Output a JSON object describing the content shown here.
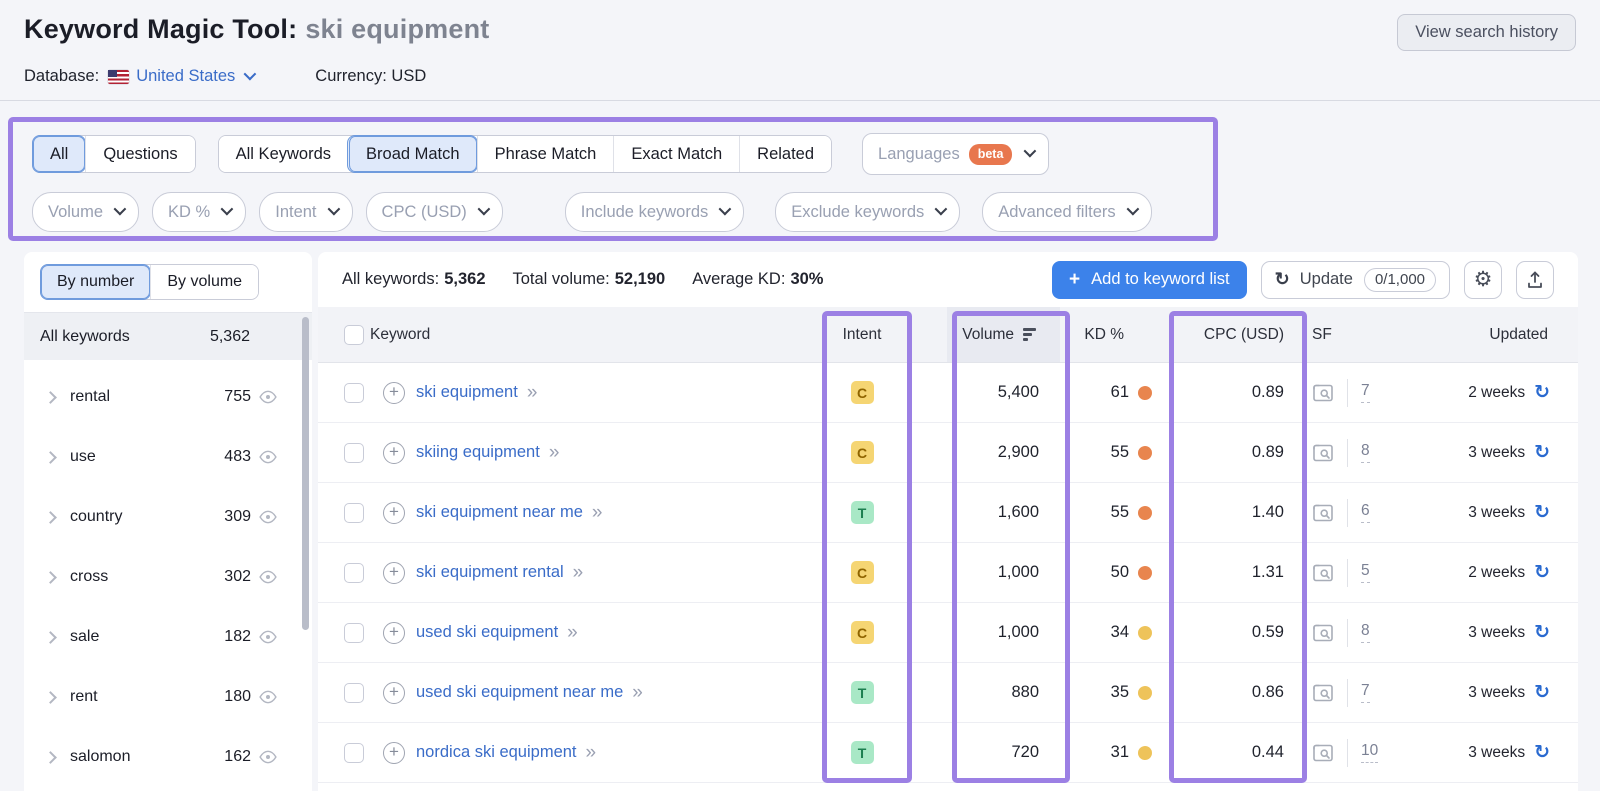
{
  "header": {
    "title": "Keyword Magic Tool:",
    "query": "ski equipment",
    "database_label": "Database:",
    "database_value": "United States",
    "currency_label": "Currency:",
    "currency_value": "USD",
    "view_history_label": "View search history"
  },
  "filters": {
    "scope_tabs": [
      {
        "label": "All",
        "selected": true
      },
      {
        "label": "Questions",
        "selected": false
      }
    ],
    "match_tabs": [
      {
        "label": "All Keywords",
        "selected": false
      },
      {
        "label": "Broad Match",
        "selected": true
      },
      {
        "label": "Phrase Match",
        "selected": false
      },
      {
        "label": "Exact Match",
        "selected": false
      },
      {
        "label": "Related",
        "selected": false
      }
    ],
    "languages": {
      "label": "Languages",
      "badge": "beta"
    },
    "dropdowns": [
      {
        "label": "Volume"
      },
      {
        "label": "KD %"
      },
      {
        "label": "Intent"
      },
      {
        "label": "CPC (USD)"
      },
      {
        "label": "Include keywords"
      },
      {
        "label": "Exclude keywords"
      },
      {
        "label": "Advanced filters"
      }
    ]
  },
  "sidebar": {
    "tabs": [
      {
        "label": "By number",
        "selected": true
      },
      {
        "label": "By volume",
        "selected": false
      }
    ],
    "all_row": {
      "label": "All keywords",
      "count": "5,362"
    },
    "groups": [
      {
        "label": "rental",
        "count": "755"
      },
      {
        "label": "use",
        "count": "483"
      },
      {
        "label": "country",
        "count": "309"
      },
      {
        "label": "cross",
        "count": "302"
      },
      {
        "label": "sale",
        "count": "182"
      },
      {
        "label": "rent",
        "count": "180"
      },
      {
        "label": "salomon",
        "count": "162"
      }
    ]
  },
  "toolbar": {
    "stats": [
      {
        "label": "All keywords:",
        "value": "5,362"
      },
      {
        "label": "Total volume:",
        "value": "52,190"
      },
      {
        "label": "Average KD:",
        "value": "30%"
      }
    ],
    "add_plus": "+",
    "add_label": "Add to keyword list",
    "update_label": "Update",
    "update_count": "0/1,000"
  },
  "table": {
    "columns": {
      "keyword": "Keyword",
      "intent": "Intent",
      "volume": "Volume",
      "kd": "KD %",
      "cpc": "CPC (USD)",
      "sf": "SF",
      "updated": "Updated"
    },
    "rows": [
      {
        "keyword": "ski equipment",
        "intent": "C",
        "volume": "5,400",
        "kd": "61",
        "kd_level": "orange",
        "cpc": "0.89",
        "sf": "7",
        "updated": "2 weeks"
      },
      {
        "keyword": "skiing equipment",
        "intent": "C",
        "volume": "2,900",
        "kd": "55",
        "kd_level": "orange",
        "cpc": "0.89",
        "sf": "8",
        "updated": "3 weeks"
      },
      {
        "keyword": "ski equipment near me",
        "intent": "T",
        "volume": "1,600",
        "kd": "55",
        "kd_level": "orange",
        "cpc": "1.40",
        "sf": "6",
        "updated": "3 weeks"
      },
      {
        "keyword": "ski equipment rental",
        "intent": "C",
        "volume": "1,000",
        "kd": "50",
        "kd_level": "orange",
        "cpc": "1.31",
        "sf": "5",
        "updated": "2 weeks"
      },
      {
        "keyword": "used ski equipment",
        "intent": "C",
        "volume": "1,000",
        "kd": "34",
        "kd_level": "yellow",
        "cpc": "0.59",
        "sf": "8",
        "updated": "3 weeks"
      },
      {
        "keyword": "used ski equipment near me",
        "intent": "T",
        "volume": "880",
        "kd": "35",
        "kd_level": "yellow",
        "cpc": "0.86",
        "sf": "7",
        "updated": "3 weeks"
      },
      {
        "keyword": "nordica ski equipment",
        "intent": "T",
        "volume": "720",
        "kd": "31",
        "kd_level": "yellow",
        "cpc": "0.44",
        "sf": "10",
        "updated": "3 weeks"
      }
    ]
  },
  "colors": {
    "accent-purple": "#9c80e4",
    "primary-blue": "#3c82ea",
    "link-blue": "#3a6cc8",
    "selected-bg": "#dfe9fa",
    "selected-border": "#6f9bdd",
    "beta-orange": "#e8774e",
    "kd-orange": "#e8854e",
    "kd-yellow": "#eec35a",
    "intent-c-bg": "#f5d573",
    "intent-c-fg": "#8f6400",
    "intent-t-bg": "#a9e8c6",
    "intent-t-fg": "#1d7f50"
  }
}
